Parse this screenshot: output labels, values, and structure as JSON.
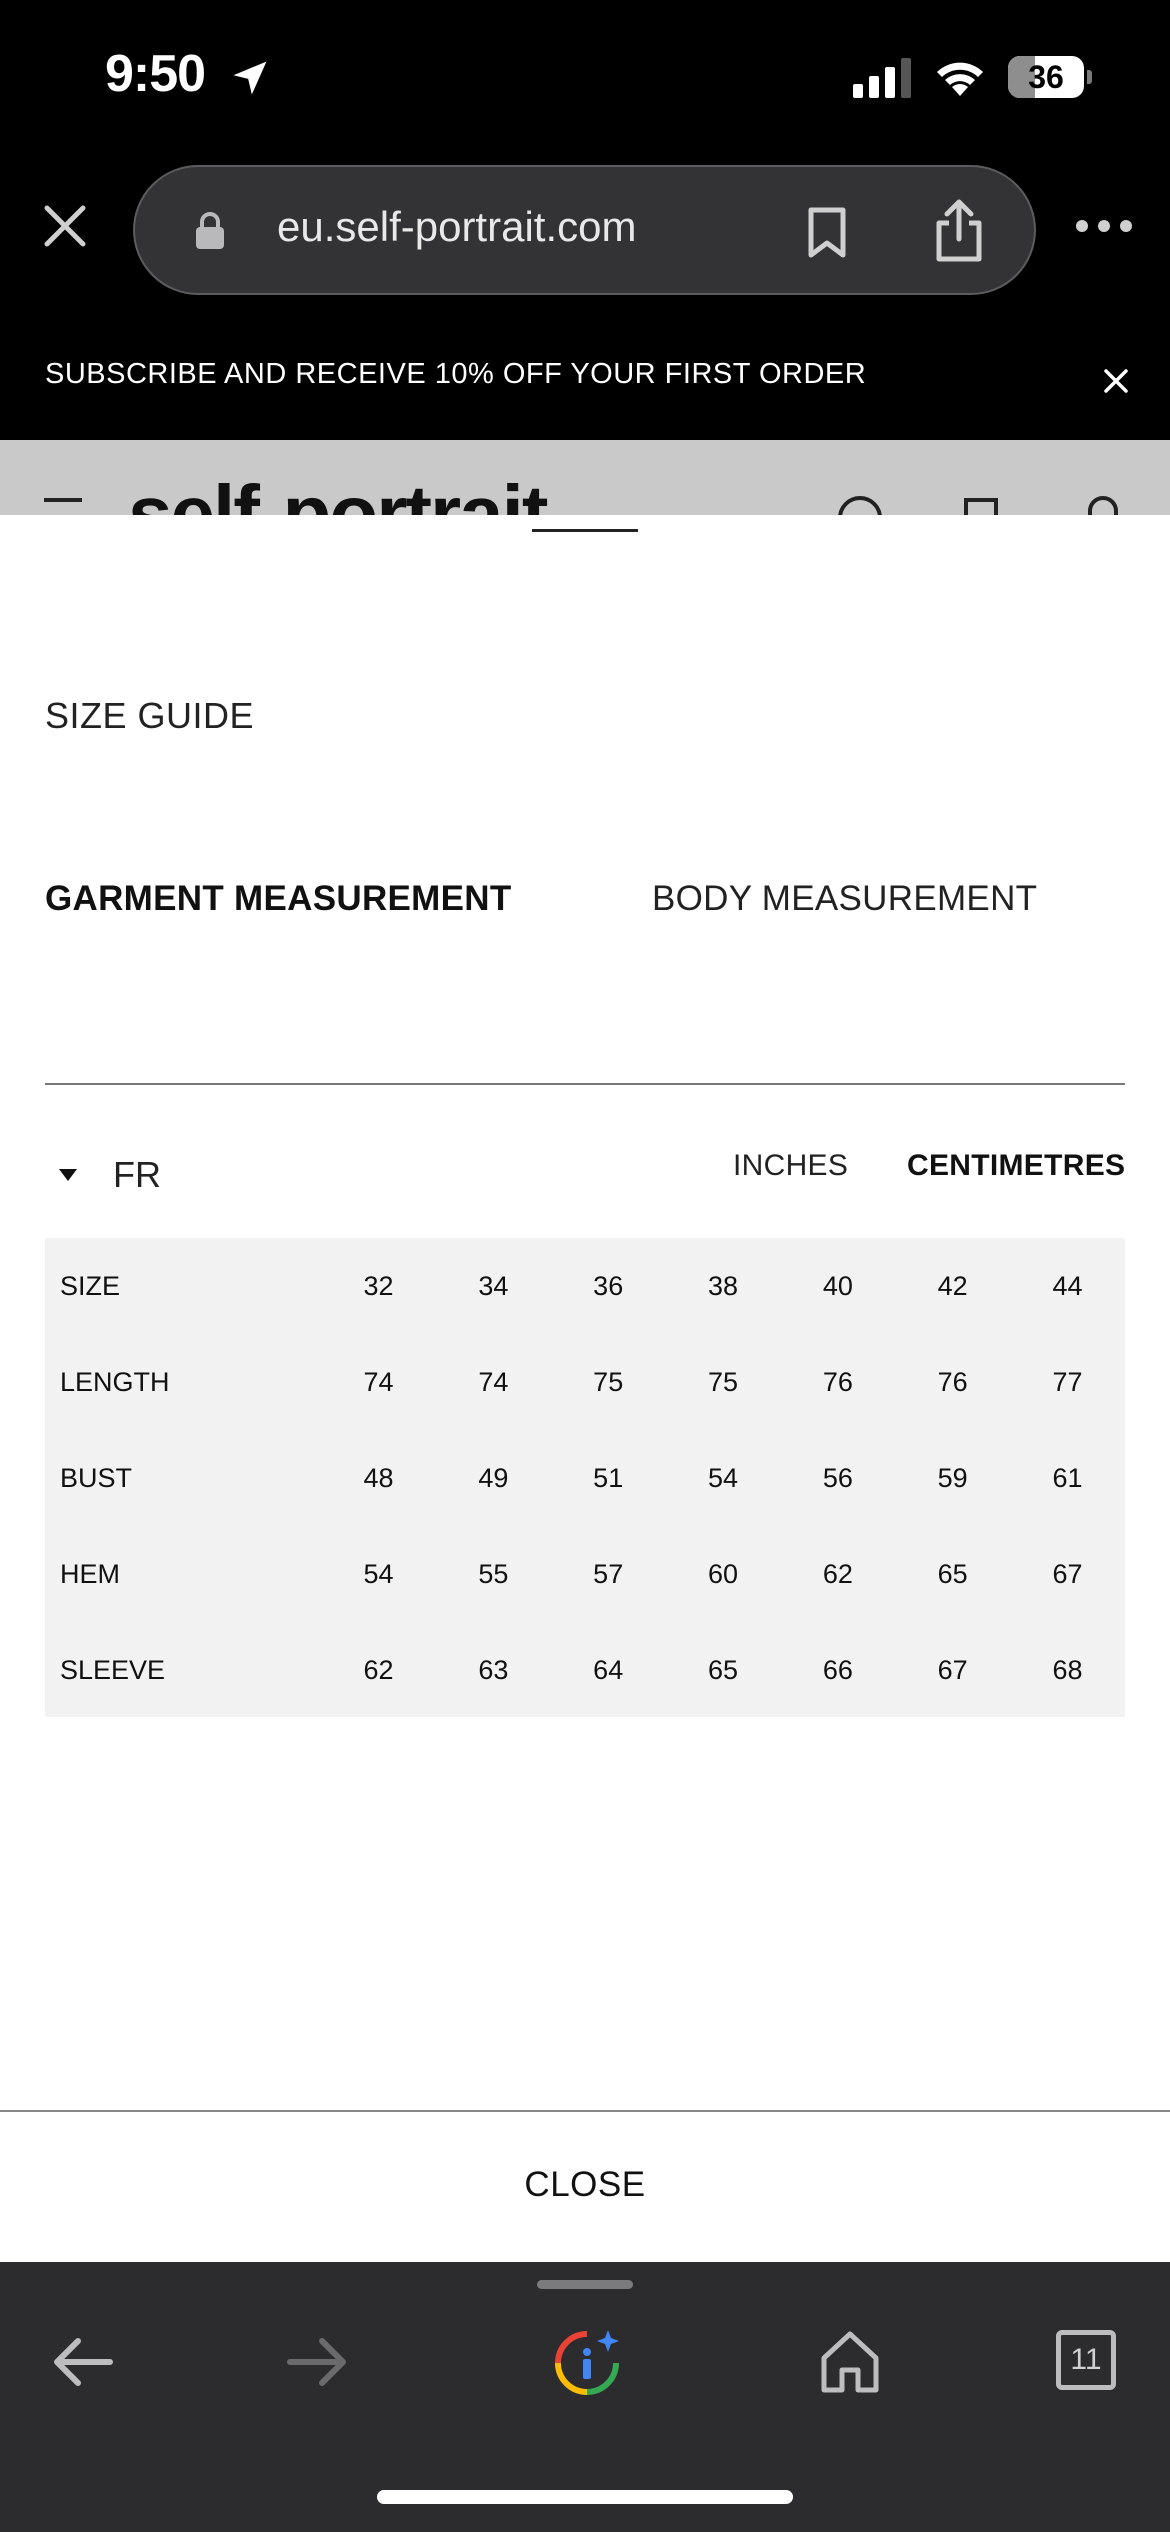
{
  "status_bar": {
    "time": "9:50",
    "battery": "36",
    "battery_level": 0.36
  },
  "browser": {
    "url": "eu.self-portrait.com"
  },
  "promo": {
    "text": "SUBSCRIBE AND RECEIVE 10% OFF YOUR FIRST ORDER"
  },
  "site": {
    "logo": "self-portrait"
  },
  "size_guide": {
    "title": "SIZE GUIDE",
    "tabs": [
      "GARMENT MEASUREMENT",
      "BODY MEASUREMENT"
    ],
    "active_tab": "GARMENT MEASUREMENT",
    "region": "FR",
    "units": [
      "INCHES",
      "CENTIMETRES"
    ],
    "active_unit": "CENTIMETRES",
    "table": [
      {
        "label": "SIZE",
        "values": [
          "32",
          "34",
          "36",
          "38",
          "40",
          "42",
          "44"
        ]
      },
      {
        "label": "LENGTH",
        "values": [
          "74",
          "74",
          "75",
          "75",
          "76",
          "76",
          "77"
        ]
      },
      {
        "label": "BUST",
        "values": [
          "48",
          "49",
          "51",
          "54",
          "56",
          "59",
          "61"
        ]
      },
      {
        "label": "HEM",
        "values": [
          "54",
          "55",
          "57",
          "60",
          "62",
          "65",
          "67"
        ]
      },
      {
        "label": "SLEEVE",
        "values": [
          "62",
          "63",
          "64",
          "65",
          "66",
          "67",
          "68"
        ]
      }
    ],
    "close_label": "CLOSE"
  },
  "toolbar": {
    "tab_count": "11"
  },
  "colors": {
    "assistant_icon": [
      "#ea4335",
      "#fbbc04",
      "#34a853",
      "#4285f4"
    ]
  }
}
